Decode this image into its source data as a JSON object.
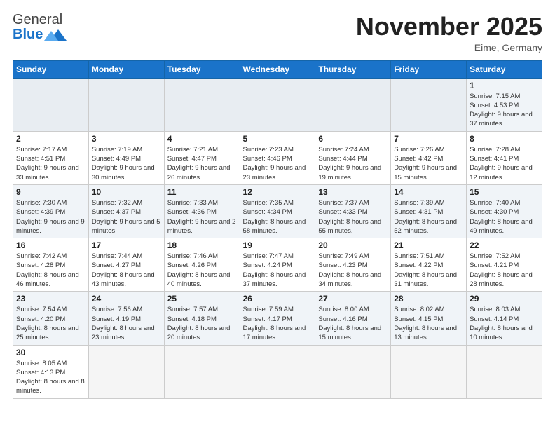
{
  "logo": {
    "text_general": "General",
    "text_blue": "Blue"
  },
  "header": {
    "month_year": "November 2025",
    "location": "Eime, Germany"
  },
  "weekdays": [
    "Sunday",
    "Monday",
    "Tuesday",
    "Wednesday",
    "Thursday",
    "Friday",
    "Saturday"
  ],
  "weeks": [
    [
      {
        "day": "",
        "info": ""
      },
      {
        "day": "",
        "info": ""
      },
      {
        "day": "",
        "info": ""
      },
      {
        "day": "",
        "info": ""
      },
      {
        "day": "",
        "info": ""
      },
      {
        "day": "",
        "info": ""
      },
      {
        "day": "1",
        "info": "Sunrise: 7:15 AM\nSunset: 4:53 PM\nDaylight: 9 hours and 37 minutes."
      }
    ],
    [
      {
        "day": "2",
        "info": "Sunrise: 7:17 AM\nSunset: 4:51 PM\nDaylight: 9 hours and 33 minutes."
      },
      {
        "day": "3",
        "info": "Sunrise: 7:19 AM\nSunset: 4:49 PM\nDaylight: 9 hours and 30 minutes."
      },
      {
        "day": "4",
        "info": "Sunrise: 7:21 AM\nSunset: 4:47 PM\nDaylight: 9 hours and 26 minutes."
      },
      {
        "day": "5",
        "info": "Sunrise: 7:23 AM\nSunset: 4:46 PM\nDaylight: 9 hours and 23 minutes."
      },
      {
        "day": "6",
        "info": "Sunrise: 7:24 AM\nSunset: 4:44 PM\nDaylight: 9 hours and 19 minutes."
      },
      {
        "day": "7",
        "info": "Sunrise: 7:26 AM\nSunset: 4:42 PM\nDaylight: 9 hours and 15 minutes."
      },
      {
        "day": "8",
        "info": "Sunrise: 7:28 AM\nSunset: 4:41 PM\nDaylight: 9 hours and 12 minutes."
      }
    ],
    [
      {
        "day": "9",
        "info": "Sunrise: 7:30 AM\nSunset: 4:39 PM\nDaylight: 9 hours and 9 minutes."
      },
      {
        "day": "10",
        "info": "Sunrise: 7:32 AM\nSunset: 4:37 PM\nDaylight: 9 hours and 5 minutes."
      },
      {
        "day": "11",
        "info": "Sunrise: 7:33 AM\nSunset: 4:36 PM\nDaylight: 9 hours and 2 minutes."
      },
      {
        "day": "12",
        "info": "Sunrise: 7:35 AM\nSunset: 4:34 PM\nDaylight: 8 hours and 58 minutes."
      },
      {
        "day": "13",
        "info": "Sunrise: 7:37 AM\nSunset: 4:33 PM\nDaylight: 8 hours and 55 minutes."
      },
      {
        "day": "14",
        "info": "Sunrise: 7:39 AM\nSunset: 4:31 PM\nDaylight: 8 hours and 52 minutes."
      },
      {
        "day": "15",
        "info": "Sunrise: 7:40 AM\nSunset: 4:30 PM\nDaylight: 8 hours and 49 minutes."
      }
    ],
    [
      {
        "day": "16",
        "info": "Sunrise: 7:42 AM\nSunset: 4:28 PM\nDaylight: 8 hours and 46 minutes."
      },
      {
        "day": "17",
        "info": "Sunrise: 7:44 AM\nSunset: 4:27 PM\nDaylight: 8 hours and 43 minutes."
      },
      {
        "day": "18",
        "info": "Sunrise: 7:46 AM\nSunset: 4:26 PM\nDaylight: 8 hours and 40 minutes."
      },
      {
        "day": "19",
        "info": "Sunrise: 7:47 AM\nSunset: 4:24 PM\nDaylight: 8 hours and 37 minutes."
      },
      {
        "day": "20",
        "info": "Sunrise: 7:49 AM\nSunset: 4:23 PM\nDaylight: 8 hours and 34 minutes."
      },
      {
        "day": "21",
        "info": "Sunrise: 7:51 AM\nSunset: 4:22 PM\nDaylight: 8 hours and 31 minutes."
      },
      {
        "day": "22",
        "info": "Sunrise: 7:52 AM\nSunset: 4:21 PM\nDaylight: 8 hours and 28 minutes."
      }
    ],
    [
      {
        "day": "23",
        "info": "Sunrise: 7:54 AM\nSunset: 4:20 PM\nDaylight: 8 hours and 25 minutes."
      },
      {
        "day": "24",
        "info": "Sunrise: 7:56 AM\nSunset: 4:19 PM\nDaylight: 8 hours and 23 minutes."
      },
      {
        "day": "25",
        "info": "Sunrise: 7:57 AM\nSunset: 4:18 PM\nDaylight: 8 hours and 20 minutes."
      },
      {
        "day": "26",
        "info": "Sunrise: 7:59 AM\nSunset: 4:17 PM\nDaylight: 8 hours and 17 minutes."
      },
      {
        "day": "27",
        "info": "Sunrise: 8:00 AM\nSunset: 4:16 PM\nDaylight: 8 hours and 15 minutes."
      },
      {
        "day": "28",
        "info": "Sunrise: 8:02 AM\nSunset: 4:15 PM\nDaylight: 8 hours and 13 minutes."
      },
      {
        "day": "29",
        "info": "Sunrise: 8:03 AM\nSunset: 4:14 PM\nDaylight: 8 hours and 10 minutes."
      }
    ],
    [
      {
        "day": "30",
        "info": "Sunrise: 8:05 AM\nSunset: 4:13 PM\nDaylight: 8 hours and 8 minutes."
      },
      {
        "day": "",
        "info": ""
      },
      {
        "day": "",
        "info": ""
      },
      {
        "day": "",
        "info": ""
      },
      {
        "day": "",
        "info": ""
      },
      {
        "day": "",
        "info": ""
      },
      {
        "day": "",
        "info": ""
      }
    ]
  ]
}
